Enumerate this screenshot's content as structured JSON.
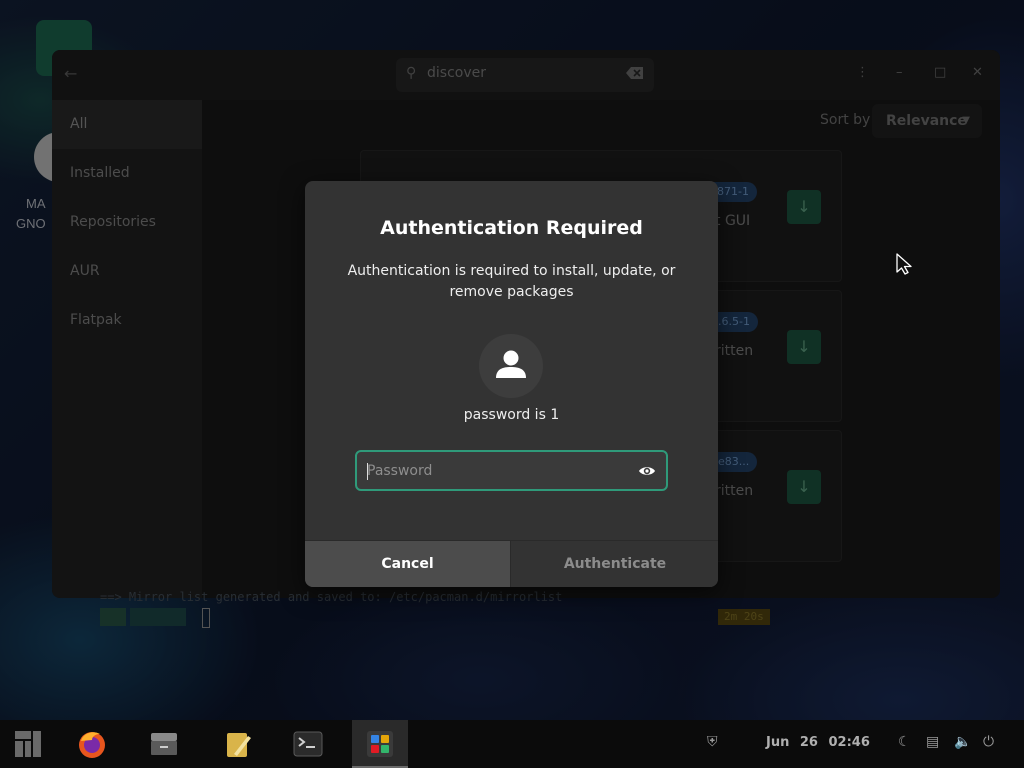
{
  "desktop": {
    "icon_labels": [
      "MA",
      "GNO"
    ]
  },
  "app": {
    "search": {
      "value": "discover"
    },
    "sidebar": {
      "items": [
        {
          "label": "All",
          "active": true
        },
        {
          "label": "Installed",
          "active": false
        },
        {
          "label": "Repositories",
          "active": false
        },
        {
          "label": "AUR",
          "active": false
        },
        {
          "label": "Flatpak",
          "active": false
        }
      ]
    },
    "sort": {
      "label": "Sort by",
      "value": "Relevance"
    },
    "results": [
      {
        "version": "c871-1",
        "desc": "t GUI"
      },
      {
        "version": "0.6.5-1",
        "desc": "ritten"
      },
      {
        "version": "4e83...",
        "desc": "ritten"
      }
    ]
  },
  "terminal": {
    "line": "==> Mirror list generated and saved to: /etc/pacman.d/mirrorlist",
    "timer": "2m 20s"
  },
  "dialog": {
    "title": "Authentication Required",
    "message": "Authentication is required to install, update, or remove packages",
    "user": "password is 1",
    "password_placeholder": "Password",
    "cancel_label": "Cancel",
    "authenticate_label": "Authenticate"
  },
  "taskbar": {
    "apps": [
      "menu",
      "firefox",
      "files",
      "text-editor",
      "terminal",
      "software"
    ],
    "clock": "Jun 26 02:46"
  },
  "colors": {
    "accent_border": "#2f9a7a",
    "dialog_bg": "#333333",
    "cancel_bg": "#4c4c4c"
  }
}
